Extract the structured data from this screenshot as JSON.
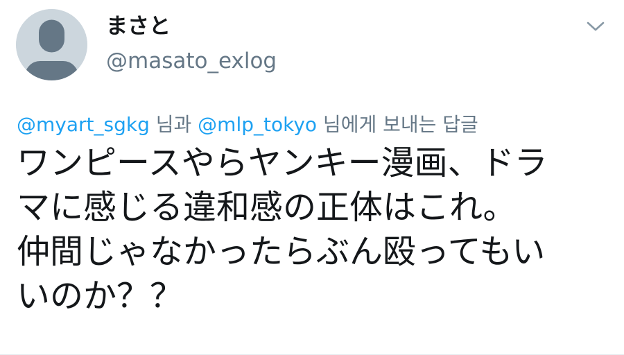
{
  "tweet": {
    "author": {
      "display_name": "まさと",
      "handle": "@masato_exlog",
      "avatar": "default-avatar-icon"
    },
    "menu_icon": "chevron-down-icon",
    "reply_context": {
      "mention_1": "@myart_sgkg",
      "connector": " 님과 ",
      "mention_2": "@mlp_tokyo",
      "suffix": " 님에게 보내는 답글"
    },
    "text_lines": [
      "ワンピースやらヤンキー漫画、ドラ",
      "マに感じる違和感の正体はこれ。",
      "仲間じゃなかったらぶん殴ってもい",
      "いのか？？"
    ]
  },
  "colors": {
    "link": "#1da1f2",
    "secondary_text": "#657786",
    "primary_text": "#14171a",
    "avatar_bg": "#ccd6dd",
    "avatar_figure": "#657786"
  }
}
